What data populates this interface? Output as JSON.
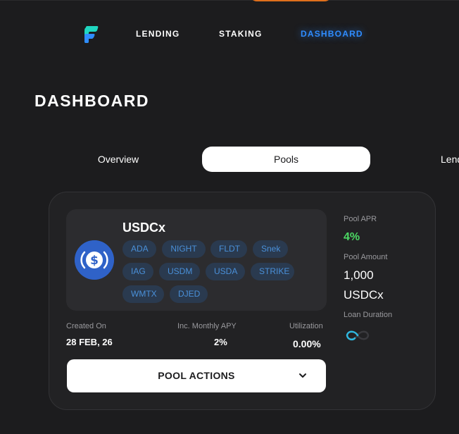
{
  "nav": {
    "items": [
      {
        "label": "LENDING"
      },
      {
        "label": "STAKING"
      },
      {
        "label": "DASHBOARD",
        "active": true
      }
    ]
  },
  "page": {
    "title": "DASHBOARD"
  },
  "tabs": [
    {
      "label": "Overview"
    },
    {
      "label": "Pools",
      "active": true
    },
    {
      "label": "Lend"
    }
  ],
  "pool": {
    "token_name": "USDCx",
    "token_icon": "usdc-coin-icon",
    "chips": [
      "ADA",
      "NIGHT",
      "FLDT",
      "Snek",
      "IAG",
      "USDM",
      "USDA",
      "STRIKE",
      "WMTX",
      "DJED"
    ],
    "created_on_label": "Created On",
    "created_on_value": "28 FEB, 26",
    "apy_label": "Inc. Monthly APY",
    "apy_value": "2%",
    "utilization_label": "Utilization",
    "utilization_value": "0.00%",
    "apr_label": "Pool APR",
    "apr_value": "4%",
    "amount_label": "Pool Amount",
    "amount_value": "1,000",
    "amount_unit": "USDCx",
    "loan_duration_label": "Loan Duration",
    "actions_label": "POOL ACTIONS"
  },
  "colors": {
    "background": "#1c1c1e",
    "accent_blue": "#2f8cff",
    "apr_green": "#4cd964",
    "chip_bg": "#2a3a4f",
    "chip_text": "#4a90d9",
    "usdc_blue": "#2f62c8",
    "top_orange": "#e0701c"
  }
}
